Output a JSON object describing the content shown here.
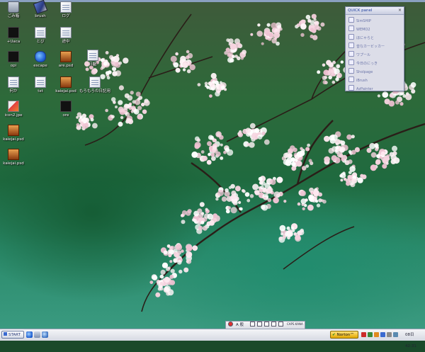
{
  "desktop": {
    "icons": [
      {
        "label": "ごみ箱",
        "glyph": "recycle-bin-icon",
        "style": "g-bin"
      },
      {
        "label": "brush",
        "glyph": "brush-icon",
        "style": "g-brush"
      },
      {
        "label": "ログ",
        "glyph": "document-icon",
        "style": "g-doc"
      },
      {
        "label": "+Uaca",
        "glyph": "app-icon",
        "style": "g-black"
      },
      {
        "label": "とび",
        "glyph": "document-icon",
        "style": "g-doc"
      },
      {
        "label": "途中",
        "glyph": "document-icon",
        "style": "g-doc"
      },
      {
        "label": "日記",
        "glyph": "document-icon",
        "style": "g-doc"
      },
      {
        "label": "opi",
        "glyph": "app-icon",
        "style": "g-black"
      },
      {
        "label": "escape",
        "glyph": "globe-icon",
        "style": "g-blue"
      },
      {
        "label": "are.psd",
        "glyph": "image-file-icon",
        "style": "g-psd"
      },
      {
        "label": "何か",
        "glyph": "document-icon",
        "style": "g-doc"
      },
      {
        "label": "txt",
        "glyph": "document-icon",
        "style": "g-doc"
      },
      {
        "label": "kaiejai.psd",
        "glyph": "image-file-icon",
        "style": "g-psd"
      },
      {
        "label": "もろもろの日記用",
        "glyph": "document-icon",
        "style": "g-doc"
      },
      {
        "label": "icon2.jpe",
        "glyph": "image-file-icon",
        "style": "g-jpg"
      },
      {
        "label": "ore",
        "glyph": "app-icon",
        "style": "g-black"
      },
      {
        "label": "kaiejai.psd",
        "glyph": "image-file-icon",
        "style": "g-psd"
      },
      {
        "label": "kaiejai.psd",
        "glyph": "image-file-icon",
        "style": "g-psd"
      }
    ]
  },
  "quick_panel": {
    "title": "QUICK panel",
    "close_glyph": "×",
    "items": [
      {
        "label": "SimSHIP",
        "icon": "app-icon"
      },
      {
        "label": "WEMO2",
        "icon": "app-icon"
      },
      {
        "label": "ほにゃらと",
        "icon": "app-icon"
      },
      {
        "label": "音なカービッカー",
        "icon": "app-icon"
      },
      {
        "label": "ワプール",
        "icon": "app-icon"
      },
      {
        "label": "今日のにっき",
        "icon": "app-icon"
      },
      {
        "label": "Sholpage",
        "icon": "app-icon"
      },
      {
        "label": "iBrush",
        "icon": "app-icon"
      },
      {
        "label": "AzPainter",
        "icon": "app-icon"
      }
    ]
  },
  "taskbar": {
    "start_label": "START",
    "ime_label": "A 般",
    "ime_caps": "CAPS KANA",
    "norton_label": "Norton™",
    "clock": "08日42:31",
    "colors": {
      "accent": "#3a6ad0",
      "norton": "#e2a800"
    }
  }
}
